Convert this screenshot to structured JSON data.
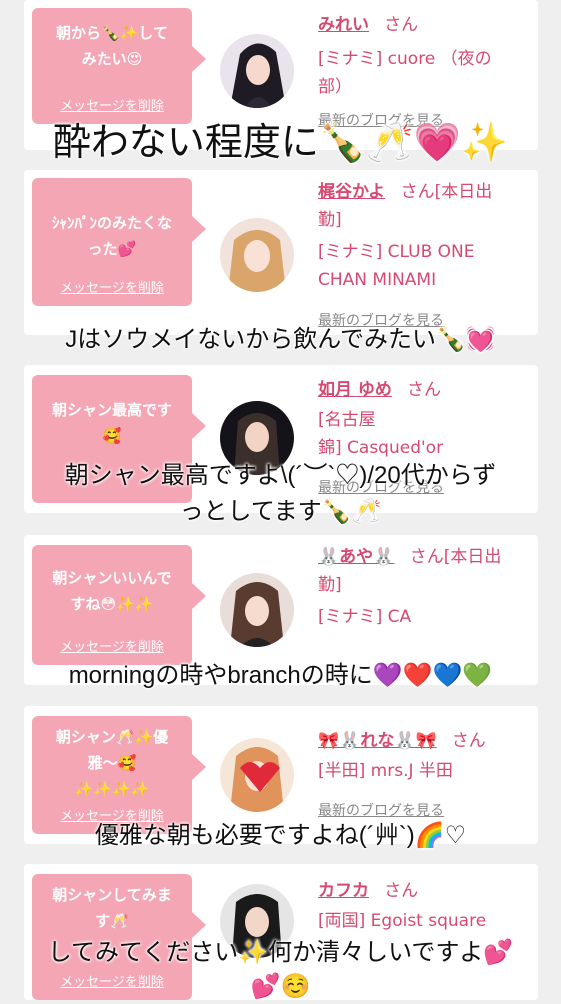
{
  "delete_label": "メッセージを削除",
  "blog_label": "最新のブログを見る",
  "san_label": "さん",
  "cards": [
    {
      "message": "朝から🍾✨して\nみたい😍",
      "name": "みれい",
      "status": "",
      "shop": "[ミナミ] cuore （夜の\n部）"
    },
    {
      "message": "ｼｬﾝﾊﾟﾝのみたくな\nった💕",
      "name": "梶谷かよ",
      "status": "[本日出\n勤]",
      "shop": "[ミナミ] CLUB ONE\nCHAN MINAMI"
    },
    {
      "message": "朝シャン最高です\n🥰",
      "name": "如月 ゆめ",
      "status": "",
      "shop": "[名古屋\n錦] Casqued'or"
    },
    {
      "message": "朝シャンいいんで\nすね😳✨✨",
      "name": "🐰あや🐰",
      "status": "[本日出\n勤]",
      "shop": "[ミナミ] CA"
    },
    {
      "message": "朝シャン🥂✨優\n雅〜🥰\n✨✨✨✨",
      "name": "🎀🐰れな🐰🎀",
      "status": "",
      "shop": "[半田] mrs.J 半田"
    },
    {
      "message": "朝シャンしてみま\nす🥂",
      "name": "カフカ",
      "status": "",
      "shop": "[両国] Egoist square"
    }
  ],
  "captions": [
    "酔わない程度に🍾🥂💗✨",
    "Jはソウメイないから飲んでみたい🍾💓",
    "朝シャン最高ですよ\\(´︶`♡)/20代からず\nっとしてます🍾🥂",
    "morningの時やbranchの時に💜❤️💙💚",
    "優雅な朝も必要ですよね(´艸`)🌈♡",
    "してみてください✨何か清々しいですよ💕\n💕☺️"
  ]
}
